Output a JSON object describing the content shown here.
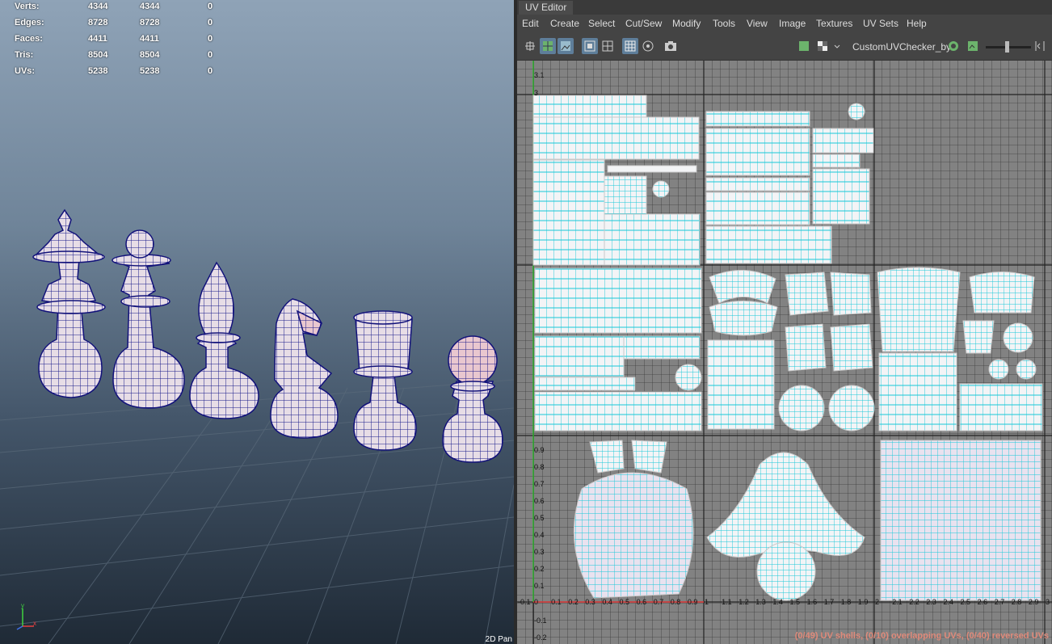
{
  "viewport": {
    "stats": [
      {
        "label": "Verts:",
        "v1": "4344",
        "v2": "4344",
        "v3": "0"
      },
      {
        "label": "Edges:",
        "v1": "8728",
        "v2": "8728",
        "v3": "0"
      },
      {
        "label": "Faces:",
        "v1": "4411",
        "v2": "4411",
        "v3": "0"
      },
      {
        "label": "Tris:",
        "v1": "8504",
        "v2": "8504",
        "v3": "0"
      },
      {
        "label": "UVs:",
        "v1": "5238",
        "v2": "5238",
        "v3": "0"
      }
    ],
    "panel_label": "2D Pan",
    "axis_y": "y",
    "axis_x": "x"
  },
  "uv_editor": {
    "title": "UV Editor",
    "menus": [
      "Edit",
      "Create",
      "Select",
      "Cut/Sew",
      "Modify",
      "Tools",
      "View",
      "Image",
      "Textures",
      "UV Sets",
      "Help"
    ],
    "texture_name": "CustomUVChecker_by",
    "left_ticks": [
      "3.1",
      "3",
      "0.9",
      "0.8",
      "0.7",
      "0.6",
      "0.5",
      "0.4",
      "0.3",
      "0.2",
      "0.1",
      "-0.1",
      "-0.2"
    ],
    "bottom_ticks": [
      "-0.1",
      "0",
      "0.1",
      "0.2",
      "0.3",
      "0.4",
      "0.5",
      "0.6",
      "0.7",
      "0.8",
      "0.9",
      "1",
      "1.1",
      "1.2",
      "1.3",
      "1.4",
      "1.5",
      "1.6",
      "1.7",
      "1.8",
      "1.9",
      "2",
      "2.1",
      "2.2",
      "2.3",
      "2.4",
      "2.5",
      "2.6",
      "2.7",
      "2.8",
      "2.9",
      "3"
    ],
    "status": "(0/49) UV shells, (0/10) overlapping UVs, (0/40) reversed UVs"
  }
}
